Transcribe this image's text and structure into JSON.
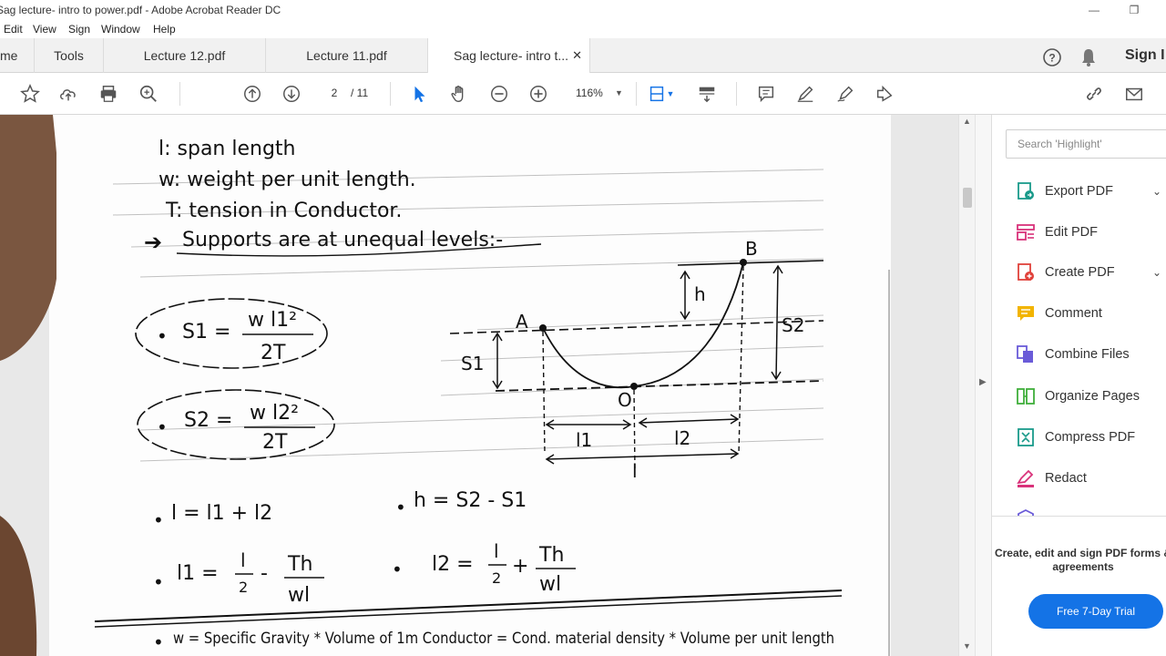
{
  "window": {
    "title": "Sag lecture- intro to power.pdf - Adobe Acrobat Reader DC"
  },
  "menu": {
    "items": [
      "Edit",
      "View",
      "Sign",
      "Window",
      "Help"
    ]
  },
  "tabs": {
    "home": "me",
    "tools": "Tools",
    "doc_tabs": [
      {
        "label": "Lecture 12.pdf"
      },
      {
        "label": "Lecture 11.pdf"
      },
      {
        "label": "Sag lecture- intro t...",
        "active": true
      }
    ],
    "sign_in": "Sign I"
  },
  "toolbar": {
    "page_current": "2",
    "page_total": "/ 11",
    "zoom": "116%"
  },
  "document": {
    "lines": {
      "span": "l: span length",
      "weight": "w: weight per unit length.",
      "tension": "T: tension in Conductor.",
      "supports": "Supports are at unequal levels:-"
    },
    "formulas": {
      "s1_lhs": "S1 =",
      "s1_num": "w l1²",
      "s1_den": "2T",
      "s2_lhs": "S2 =",
      "s2_num": "w l2²",
      "s2_den": "2T",
      "l_sum": "l = l1 + l2",
      "h_diff": "h = S2 - S1",
      "l1_lhs": "l1 =",
      "l1_a": "l",
      "l1_a_den": "2",
      "l1_op": "-",
      "l1_b": "Th",
      "l1_b_den": "wl",
      "l2_lhs": "l2 =",
      "l2_a": "l",
      "l2_a_den": "2",
      "l2_op": "+",
      "l2_b": "Th",
      "l2_b_den": "wl",
      "w_def": "w = Specific Gravity * Volume of 1m Conductor = Cond. material density * Volume per unit length"
    },
    "diagram": {
      "point_a": "A",
      "point_b": "B",
      "point_o": "O",
      "h": "h",
      "s1": "S1",
      "s2": "S2",
      "l1": "l1",
      "l2": "l2",
      "l": "l"
    }
  },
  "right_pane": {
    "search_placeholder": "Search 'Highlight'",
    "tools": [
      {
        "label": "Export PDF",
        "icon": "export-pdf-icon",
        "color": "#1a9a8a",
        "chevron": "⌄"
      },
      {
        "label": "Edit PDF",
        "icon": "edit-pdf-icon",
        "color": "#d9327a"
      },
      {
        "label": "Create PDF",
        "icon": "create-pdf-icon",
        "color": "#e0413a",
        "chevron": "⌄"
      },
      {
        "label": "Comment",
        "icon": "comment-icon",
        "color": "#f2b400"
      },
      {
        "label": "Combine Files",
        "icon": "combine-files-icon",
        "color": "#6a5bd8"
      },
      {
        "label": "Organize Pages",
        "icon": "organize-pages-icon",
        "color": "#3fae3a"
      },
      {
        "label": "Compress PDF",
        "icon": "compress-pdf-icon",
        "color": "#1a9a8a"
      },
      {
        "label": "Redact",
        "icon": "redact-icon",
        "color": "#d9327a"
      }
    ],
    "promo_text": "Create, edit and sign PDF forms & agreements",
    "trial_button": "Free 7-Day Trial"
  }
}
